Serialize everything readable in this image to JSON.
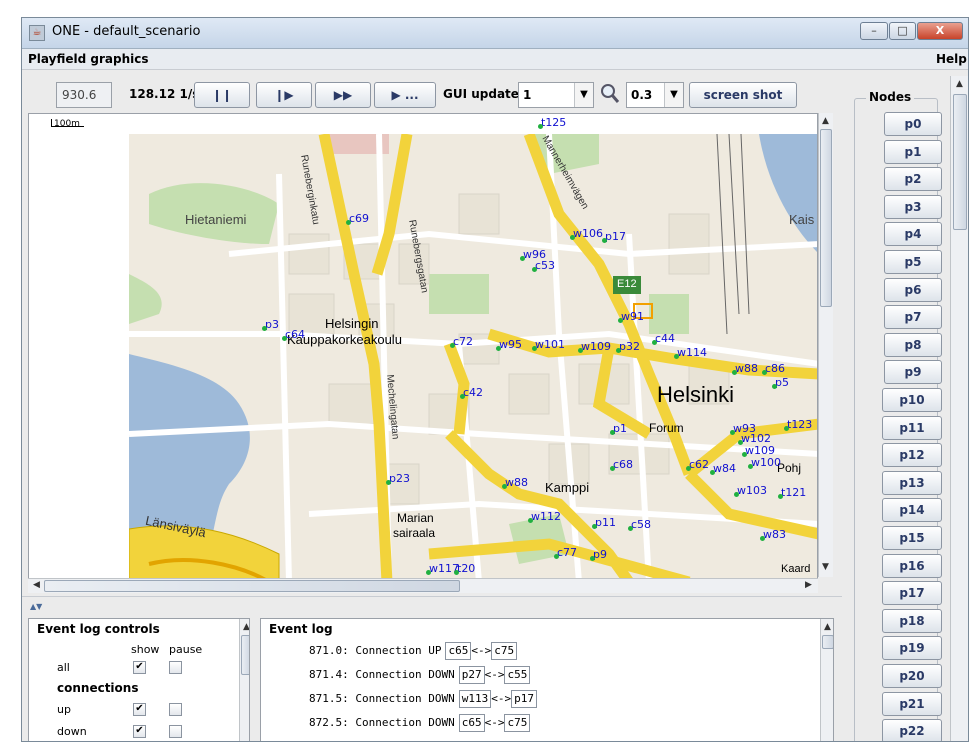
{
  "window": {
    "title": "ONE - default_scenario",
    "controls": {
      "minimize": "–",
      "maximize": "□",
      "close": "X"
    }
  },
  "menu": {
    "left": "Playfield graphics",
    "right": "Help"
  },
  "toolbar": {
    "sim_time": "930.6",
    "sim_speed": "128.12 1/s",
    "pause_label": "❙❙",
    "step_label": "❙▶",
    "ffw_label": "▶▶",
    "play_until_label": "▶ ...",
    "gui_update_label": "GUI update:",
    "gui_update_value": "1",
    "zoom_value": "0.3",
    "screenshot_label": "screen shot"
  },
  "map": {
    "scale_label": "100m",
    "places": {
      "hietaniemi": "Hietaniemi",
      "helsingin": "Helsingin",
      "kauppakorkeakoulu": "Kauppakorkeakoulu",
      "helsinki": "Helsinki",
      "forum": "Forum",
      "kamppi": "Kamppi",
      "marian": "Marian",
      "sairaala": "sairaala",
      "kais": "Kais",
      "e12": "E12",
      "lansivayla": "Länsiväylä",
      "pohj": "Pohj",
      "runeberginkatu": "Runeberginkatu",
      "runebergsgatan": "Runebergsgatan",
      "mechelingatan": "Mechelingatan",
      "mannerheimvagen": "Mannerheimvägen",
      "kaivokatu": "Kaard"
    },
    "nodes": [
      "t125",
      "c69",
      "w96",
      "c53",
      "w106",
      "p17",
      "p3",
      "c64",
      "c72",
      "w95",
      "w101",
      "w109",
      "p32",
      "c44",
      "w91",
      "w114",
      "w88",
      "c86",
      "p5",
      "c42",
      "p1",
      "w93",
      "t123",
      "w102",
      "w109",
      "c68",
      "c62",
      "w84",
      "w100",
      "p23",
      "w88",
      "w103",
      "t121",
      "w112",
      "p11",
      "c58",
      "w83",
      "c77",
      "p9",
      "w117",
      "t20"
    ]
  },
  "nodes_panel": {
    "title": "Nodes",
    "items": [
      "p0",
      "p1",
      "p2",
      "p3",
      "p4",
      "p5",
      "p6",
      "p7",
      "p8",
      "p9",
      "p10",
      "p11",
      "p12",
      "p13",
      "p14",
      "p15",
      "p16",
      "p17",
      "p18",
      "p19",
      "p20",
      "p21",
      "p22"
    ]
  },
  "event_log_controls": {
    "title": "Event log controls",
    "col_show": "show",
    "col_pause": "pause",
    "rows": [
      {
        "label": "all",
        "show": "✔",
        "pause": ""
      },
      {
        "label": "connections",
        "header": true
      },
      {
        "label": "up",
        "show": "✔",
        "pause": ""
      },
      {
        "label": "down",
        "show": "✔",
        "pause": ""
      }
    ]
  },
  "event_log": {
    "title": "Event log",
    "entries": [
      {
        "time": "871.0: Connection UP",
        "a": "c65",
        "sep": "<->",
        "b": "c75"
      },
      {
        "time": "871.4: Connection DOWN",
        "a": "p27",
        "sep": "<->",
        "b": "c55"
      },
      {
        "time": "871.5: Connection DOWN",
        "a": "w113",
        "sep": "<->",
        "b": "p17"
      },
      {
        "time": "872.5: Connection DOWN",
        "a": "c65",
        "sep": "<->",
        "b": "c75"
      }
    ]
  }
}
